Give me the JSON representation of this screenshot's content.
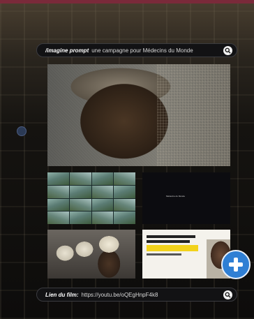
{
  "prompt_bar": {
    "label": "/imagine prompt",
    "text": "une campagne pour Médecins du Monde",
    "icon": "search-icon"
  },
  "film_bar": {
    "label": "Lien du film:",
    "text": "https://youtu.be/oQEgHnpF4k8",
    "icon": "search-icon"
  },
  "dark_card": {
    "text": "Médecins du Monde"
  },
  "logo": {
    "name": "medecins-du-monde-logo",
    "color": "#2f7fd4"
  }
}
